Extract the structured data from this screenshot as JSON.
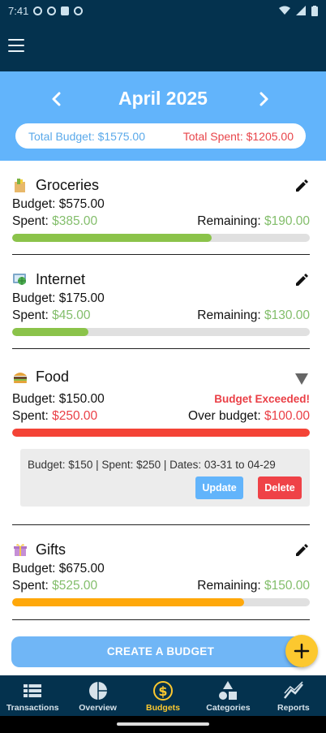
{
  "status_bar": {
    "time": "7:41"
  },
  "header": {
    "month": "April 2025",
    "total_budget": "Total Budget: $1575.00",
    "total_spent": "Total Spent: $1205.00"
  },
  "budgets": [
    {
      "name": "Groceries",
      "icon": "grocery-bag-icon",
      "budget": "Budget: $575.00",
      "spent_label": "Spent:",
      "spent": "$385.00",
      "remaining_label": "Remaining:",
      "remaining": "$190.00",
      "progress": 0.67,
      "bar_color": "#8bc34a"
    },
    {
      "name": "Internet",
      "icon": "globe-computer-icon",
      "budget": "Budget: $175.00",
      "spent_label": "Spent:",
      "spent": "$45.00",
      "remaining_label": "Remaining:",
      "remaining": "$130.00",
      "progress": 0.257,
      "bar_color": "#8bc34a"
    },
    {
      "name": "Food",
      "icon": "burger-icon",
      "budget": "Budget: $150.00",
      "status": "Budget Exceeded!",
      "spent_label": "Spent:",
      "spent": "$250.00",
      "over_label": "Over budget:",
      "over": "$100.00",
      "progress": 1.0,
      "bar_color": "#f44336",
      "details": {
        "text": "Budget: $150 | Spent: $250 | Dates: 03-31 to 04-29",
        "update_label": "Update",
        "delete_label": "Delete"
      }
    },
    {
      "name": "Gifts",
      "icon": "gift-icon",
      "budget": "Budget: $675.00",
      "spent_label": "Spent:",
      "spent": "$525.00",
      "remaining_label": "Remaining:",
      "remaining": "$150.00",
      "progress": 0.778,
      "bar_color": "#ffa80a"
    }
  ],
  "create_button": "CREATE A BUDGET",
  "nav": [
    {
      "label": "Transactions",
      "icon": "list-icon"
    },
    {
      "label": "Overview",
      "icon": "pie-chart-icon"
    },
    {
      "label": "Budgets",
      "icon": "budget-dollar-icon",
      "active": true
    },
    {
      "label": "Categories",
      "icon": "shapes-icon"
    },
    {
      "label": "Reports",
      "icon": "trend-chart-icon"
    }
  ],
  "colors": {
    "primary_dark": "#04324e",
    "header_blue": "#62b4fb",
    "accent_yellow": "#fcc82f",
    "green": "#83be6b",
    "red": "#ea3f46"
  }
}
